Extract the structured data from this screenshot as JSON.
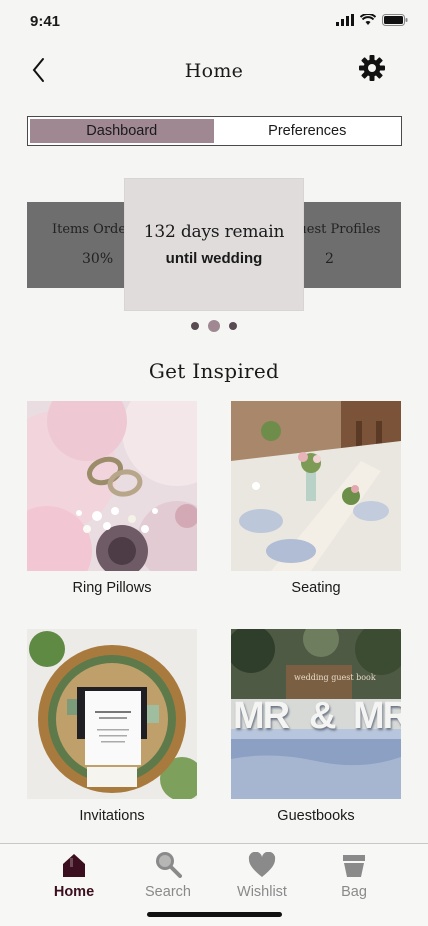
{
  "status": {
    "time": "9:41"
  },
  "header": {
    "title": "Home"
  },
  "segmented": {
    "tabs": [
      "Dashboard",
      "Preferences"
    ],
    "active": "Dashboard"
  },
  "carousel": {
    "left_card": {
      "label": "Items Ordered",
      "value": "30%"
    },
    "center_card": {
      "title": "132 days remain",
      "subtitle": "until wedding"
    },
    "right_card": {
      "label": "Guest Profiles",
      "value": "2"
    },
    "dots": 3,
    "active_dot": 1
  },
  "inspire": {
    "title": "Get Inspired",
    "items": [
      {
        "label": "Ring Pillows"
      },
      {
        "label": "Seating"
      },
      {
        "label": "Invitations"
      },
      {
        "label": "Guestbooks"
      }
    ]
  },
  "guestbook_sign": {
    "letters_left": "MR",
    "amp": "&",
    "letters_right": "MR",
    "small_text": "wedding guest book"
  },
  "tabbar": {
    "items": [
      {
        "label": "Home",
        "icon": "home-icon"
      },
      {
        "label": "Search",
        "icon": "search-icon"
      },
      {
        "label": "Wishlist",
        "icon": "heart-icon"
      },
      {
        "label": "Bag",
        "icon": "bag-icon"
      }
    ],
    "active": "Home"
  },
  "colors": {
    "accent": "#a08893",
    "dark_accent": "#3b0f1f",
    "side_card": "#6e6e6e",
    "center_card": "#e0dcdc"
  }
}
